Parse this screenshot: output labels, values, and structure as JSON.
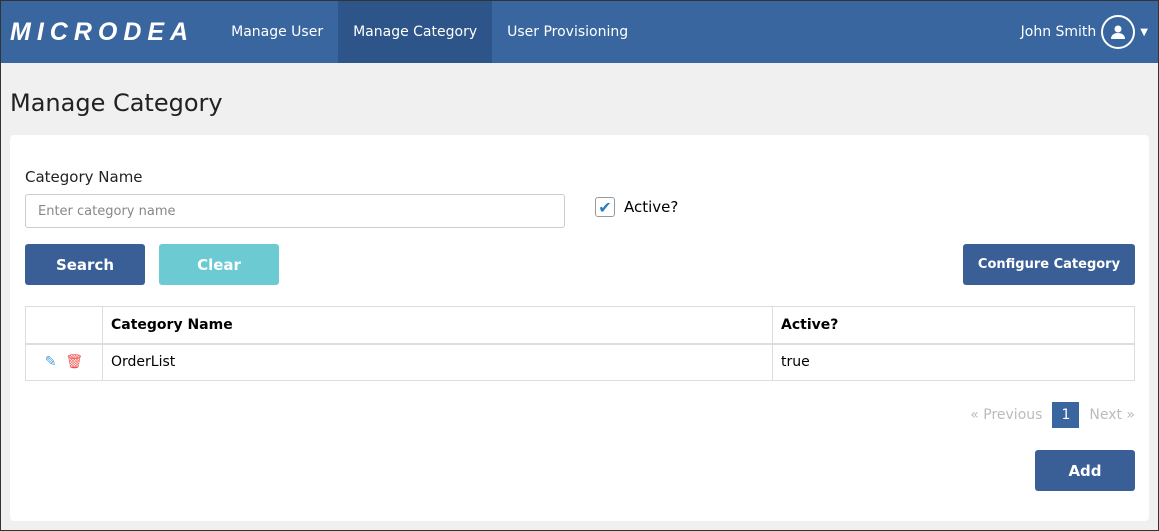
{
  "nav": {
    "logo": "MICRODEA",
    "items": [
      "Manage User",
      "Manage Category",
      "User Provisioning"
    ],
    "user": "John Smith"
  },
  "page": {
    "title": "Manage Category"
  },
  "form": {
    "label": "Category Name",
    "placeholder": "Enter category name",
    "active_label": "Active?",
    "active_checked": true
  },
  "buttons": {
    "search": "Search",
    "clear": "Clear",
    "configure": "Configure Category",
    "add": "Add"
  },
  "table": {
    "headers": [
      "",
      "Category Name",
      "Active?"
    ],
    "rows": [
      {
        "name": "OrderList",
        "active": "true"
      }
    ]
  },
  "pagination": {
    "prev": "« Previous",
    "current": "1",
    "next": "Next »"
  }
}
